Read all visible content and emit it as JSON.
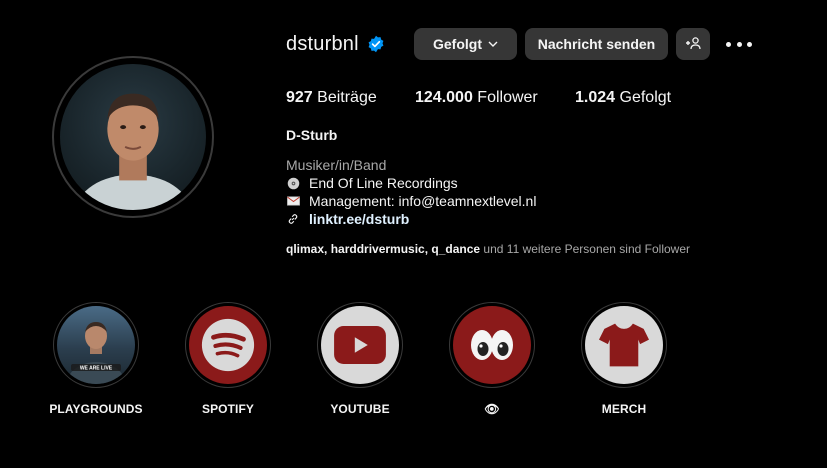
{
  "profile": {
    "username": "dsturbnl",
    "verified_icon": "verified-badge-icon",
    "buttons": {
      "following": "Gefolgt",
      "message": "Nachricht senden",
      "add_user_icon": "add-user-icon",
      "more_icon": "more-options-icon"
    },
    "stats": {
      "posts_count": "927",
      "posts_label": "Beiträge",
      "followers_count": "124.000",
      "followers_label": "Follower",
      "following_count": "1.024",
      "following_label": "Gefolgt"
    },
    "full_name": "D-Sturb",
    "category": "Musiker/in/Band",
    "bio": [
      {
        "icon": "disc-icon",
        "text": "End Of Line Recordings"
      },
      {
        "icon": "envelope-icon",
        "text": "Management: info@teamnextlevel.nl"
      }
    ],
    "link": {
      "icon": "link-icon",
      "text": "linktr.ee/dsturb"
    },
    "followed_by": {
      "names": [
        "qlimax",
        "harddrivermusic",
        "q_dance"
      ],
      "sep1": ", ",
      "sep2": ", ",
      "suffix": " und 11 weitere Personen sind Follower"
    }
  },
  "highlights": [
    {
      "label": "PLAYGROUNDS",
      "icon": "playgrounds-cover-image"
    },
    {
      "label": "SPOTIFY",
      "icon": "spotify-icon"
    },
    {
      "label": "YOUTUBE",
      "icon": "youtube-icon"
    },
    {
      "label": "👁",
      "icon": "eyes-icon"
    },
    {
      "label": "MERCH",
      "icon": "tshirt-icon"
    }
  ],
  "colors": {
    "background": "#000000",
    "button": "#363636",
    "verified": "#0095f6",
    "highlight_red": "#8b1a1a",
    "highlight_grey": "#d9d9d9",
    "muted_text": "#a8a8a8"
  }
}
